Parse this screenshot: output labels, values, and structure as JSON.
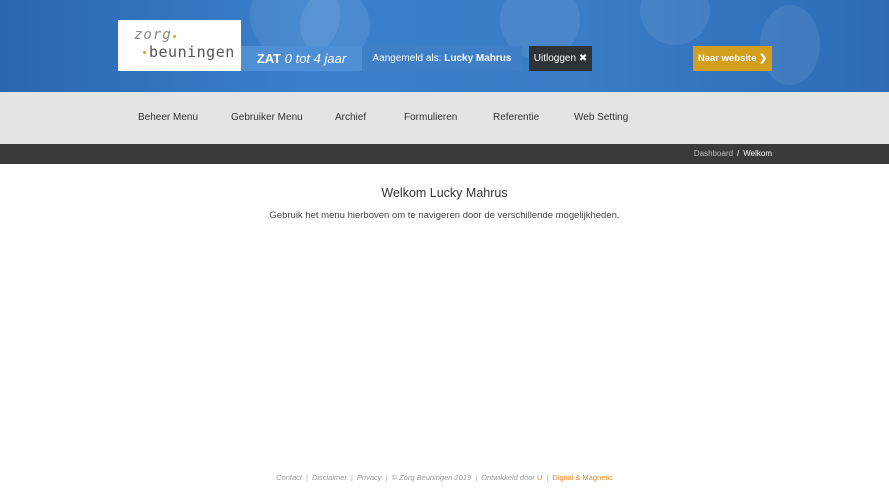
{
  "header": {
    "logo": {
      "line1": "zorg",
      "line2": "beuningen"
    },
    "program": {
      "name": "ZAT",
      "age_range": "0 tot 4 jaar"
    },
    "user": {
      "label": "Aangemeld als:",
      "name": "Lucky Mahrus"
    },
    "logout_label": "Uitloggen",
    "logout_icon": "✖",
    "website_label": "Naar website",
    "website_icon": "❯",
    "colors": {
      "header_bg": "#3a7cc6",
      "accent": "#d29e1c",
      "dark": "#2d3337"
    }
  },
  "nav": {
    "items": [
      {
        "label": "Beheer Menu"
      },
      {
        "label": "Gebruiker Menu"
      },
      {
        "label": "Archief"
      },
      {
        "label": "Formulieren"
      },
      {
        "label": "Referentie"
      },
      {
        "label": "Web Setting"
      }
    ]
  },
  "breadcrumb": {
    "items": [
      {
        "label": "Dashboard"
      },
      {
        "label": "Welkom"
      }
    ],
    "separator": "/"
  },
  "main": {
    "title": "Welkom Lucky Mahrus",
    "text": "Gebruik het menu hierboven om te navigeren door de verschillende mogelijkheden."
  },
  "footer": {
    "contact": "Contact",
    "disclaimer": "Disclaimer",
    "privacy": "Privacy",
    "copyright": "© Zorg Beuningen 2019",
    "developed_by": "Ontwikkeld door",
    "developer_u": "U",
    "developer_name": "Digital & Magnetic",
    "separator": "|"
  }
}
